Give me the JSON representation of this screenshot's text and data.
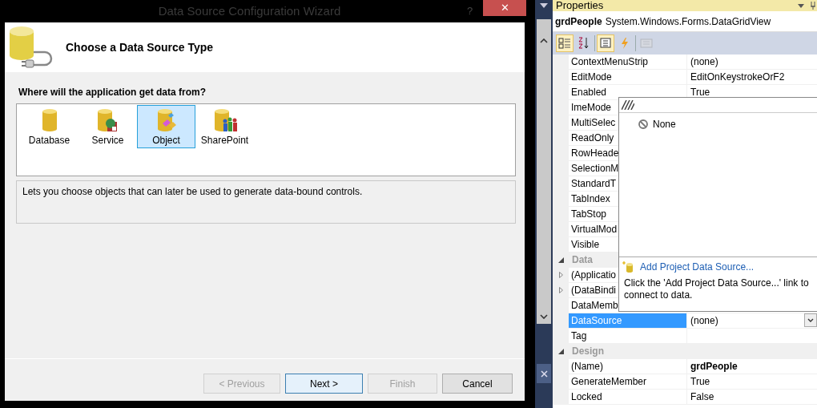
{
  "wizard": {
    "title": "Data Source Configuration Wizard",
    "help_button": "?",
    "close_button": "✕",
    "header_title": "Choose a Data Source Type",
    "prompt": "Where will the application get data from?",
    "sources": [
      {
        "label": "Database",
        "kind": "database",
        "selected": false
      },
      {
        "label": "Service",
        "kind": "service",
        "selected": false
      },
      {
        "label": "Object",
        "kind": "object",
        "selected": true
      },
      {
        "label": "SharePoint",
        "kind": "sharepoint",
        "selected": false
      }
    ],
    "description": "Lets you choose objects that can later be used to generate data-bound controls.",
    "buttons": [
      {
        "label": "< Previous",
        "disabled": true,
        "default": false
      },
      {
        "label": "Next >",
        "disabled": false,
        "default": true
      },
      {
        "label": "Finish",
        "disabled": true,
        "default": false
      },
      {
        "label": "Cancel",
        "disabled": false,
        "default": false
      }
    ]
  },
  "properties": {
    "title": "Properties",
    "object_name": "grdPeople",
    "object_type": "System.Windows.Forms.DataGridView",
    "toolbar": [
      {
        "kind": "categorized",
        "selected": true,
        "disabled": false
      },
      {
        "kind": "alphabetical",
        "selected": false,
        "disabled": false
      },
      {
        "kind": "properties",
        "selected": true,
        "disabled": false
      },
      {
        "kind": "events",
        "selected": false,
        "disabled": false
      },
      {
        "kind": "property-pages",
        "selected": false,
        "disabled": true
      }
    ],
    "rows": [
      {
        "kind": "property",
        "name": "ContextMenuStrip",
        "value": "(none)",
        "selected": false
      },
      {
        "kind": "property",
        "name": "EditMode",
        "value": "EditOnKeystrokeOrF2",
        "selected": false
      },
      {
        "kind": "property",
        "name": "Enabled",
        "value": "True",
        "selected": false
      },
      {
        "kind": "property",
        "name": "ImeMode",
        "selected": false
      },
      {
        "kind": "property",
        "name": "MultiSelec",
        "selected": false
      },
      {
        "kind": "property",
        "name": "ReadOnly",
        "selected": false
      },
      {
        "kind": "property",
        "name": "RowHeade",
        "selected": false
      },
      {
        "kind": "property",
        "name": "SelectionM",
        "selected": false
      },
      {
        "kind": "property",
        "name": "StandardT",
        "selected": false
      },
      {
        "kind": "property",
        "name": "TabIndex",
        "selected": false
      },
      {
        "kind": "property",
        "name": "TabStop",
        "selected": false
      },
      {
        "kind": "property",
        "name": "VirtualMod",
        "selected": false
      },
      {
        "kind": "property",
        "name": "Visible",
        "selected": false
      },
      {
        "kind": "category",
        "name": "Data",
        "expanded": true
      },
      {
        "kind": "property",
        "name": "(Applicatio",
        "selected": false,
        "expanded": false
      },
      {
        "kind": "property",
        "name": "(DataBindi",
        "selected": false,
        "expanded": false
      },
      {
        "kind": "property",
        "name": "DataMemb",
        "selected": false
      },
      {
        "kind": "property",
        "name": "DataSource",
        "value": "(none)",
        "selected": true,
        "dropdown": true
      },
      {
        "kind": "property",
        "name": "Tag",
        "value": "",
        "selected": false
      },
      {
        "kind": "category",
        "name": "Design",
        "expanded": true
      },
      {
        "kind": "property",
        "name": "(Name)",
        "value": "grdPeople",
        "selected": false,
        "modified": true
      },
      {
        "kind": "property",
        "name": "GenerateMember",
        "value": "True",
        "selected": false
      },
      {
        "kind": "property",
        "name": "Locked",
        "value": "False",
        "selected": false
      }
    ],
    "popup": {
      "none_label": "None",
      "link": "Add Project Data Source...",
      "help": "Click the 'Add Project Data Source...' link to connect to data."
    }
  }
}
